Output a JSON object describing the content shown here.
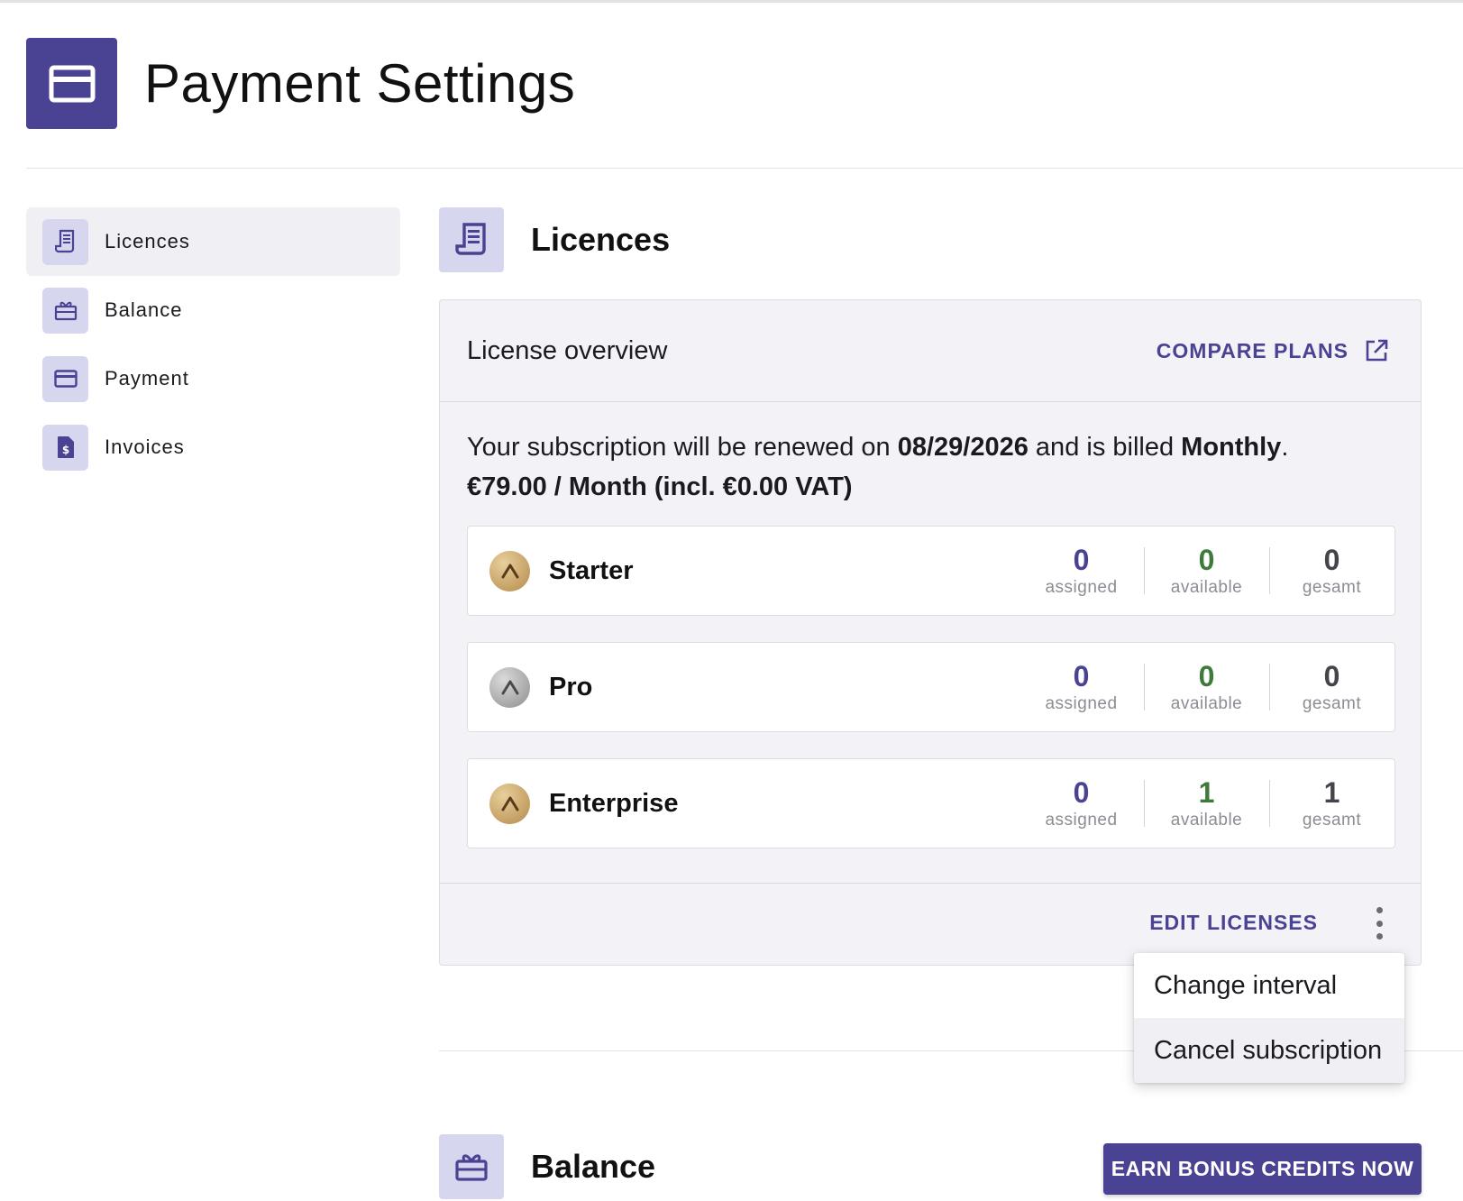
{
  "header": {
    "title": "Payment Settings",
    "icon": "credit-card-icon"
  },
  "sidebar": {
    "items": [
      {
        "label": "Licences",
        "icon": "receipt-icon",
        "active": true
      },
      {
        "label": "Balance",
        "icon": "gift-icon",
        "active": false
      },
      {
        "label": "Payment",
        "icon": "credit-card-icon",
        "active": false
      },
      {
        "label": "Invoices",
        "icon": "invoice-dollar-icon",
        "active": false
      }
    ]
  },
  "licences": {
    "title": "Licences",
    "card": {
      "title": "License overview",
      "compare_label": "COMPARE PLANS",
      "renew_prefix": "Your subscription will be renewed on ",
      "renew_date": "08/29/2026",
      "renew_mid": " and is billed ",
      "renew_interval": "Monthly",
      "renew_suffix": ".",
      "price_line": "€79.00 / Month (incl. €0.00 VAT)",
      "stat_labels": {
        "assigned": "assigned",
        "available": "available",
        "total": "gesamt"
      },
      "plans": [
        {
          "name": "Starter",
          "assigned": "0",
          "available": "0",
          "total": "0",
          "badge": "gold"
        },
        {
          "name": "Pro",
          "assigned": "0",
          "available": "0",
          "total": "0",
          "badge": "silver"
        },
        {
          "name": "Enterprise",
          "assigned": "0",
          "available": "1",
          "total": "1",
          "badge": "gold"
        }
      ],
      "edit_label": "EDIT LICENSES"
    },
    "menu": {
      "items": [
        {
          "label": "Change interval"
        },
        {
          "label": "Cancel subscription"
        }
      ]
    }
  },
  "balance": {
    "title": "Balance",
    "earn_label": "EARN BONUS CREDITS NOW"
  },
  "colors": {
    "accent": "#4a4293",
    "accent_light": "#d6d7ee",
    "available_green": "#3f7a3d"
  }
}
